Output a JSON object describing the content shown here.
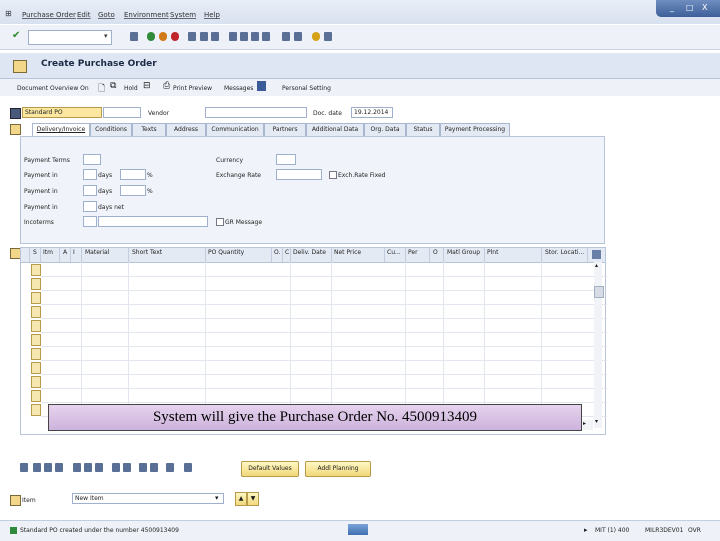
{
  "menu": {
    "items": [
      "Purchase Order",
      "Edit",
      "Goto",
      "Environment",
      "System",
      "Help"
    ],
    "win_controls": [
      "_",
      "□",
      "X"
    ]
  },
  "title": "Create Purchase Order",
  "app_toolbar": {
    "doc_overview": "Document Overview On",
    "hold": "Hold",
    "print_preview": "Print Preview",
    "messages": "Messages",
    "personal_setting": "Personal Setting"
  },
  "header": {
    "doc_type": "Standard PO",
    "vendor_label": "Vendor",
    "vendor_value": "",
    "doc_date_label": "Doc. date",
    "doc_date_value": "19.12.2014"
  },
  "tabs": [
    "Delivery/Invoice",
    "Conditions",
    "Texts",
    "Address",
    "Communication",
    "Partners",
    "Additional Data",
    "Org. Data",
    "Status",
    "Payment Processing"
  ],
  "payment": {
    "terms_label": "Payment Terms",
    "in_label_1": "Payment in",
    "in_label_2": "Payment in",
    "in_label_3": "Payment in",
    "days": "days",
    "days_net": "days net",
    "percent": "%",
    "currency_label": "Currency",
    "exch_label": "Exchange Rate",
    "exch_fixed_label": "Exch.Rate Fixed",
    "incoterms_label": "Incoterms",
    "gr_message_label": "GR Message"
  },
  "grid": {
    "columns": [
      "S",
      "Itm",
      "A",
      "I",
      "Material",
      "Short Text",
      "PO Quantity",
      "O.",
      "C",
      "Deliv. Date",
      "Net Price",
      "Cu...",
      "Per",
      "O",
      "Matl Group",
      "Plnt",
      "Stor. Locati..."
    ]
  },
  "banner_text": "System will give the Purchase Order No. 4500913409",
  "buttons": {
    "default_values": "Default Values",
    "addl_planning": "Addl Planning"
  },
  "item_selector": {
    "label": "Item",
    "value": "New Item"
  },
  "status": {
    "message": "Standard PO created under the number 4500913409",
    "system": "MIT (1) 400",
    "server": "MILR3DEV01",
    "mode": "OVR"
  }
}
